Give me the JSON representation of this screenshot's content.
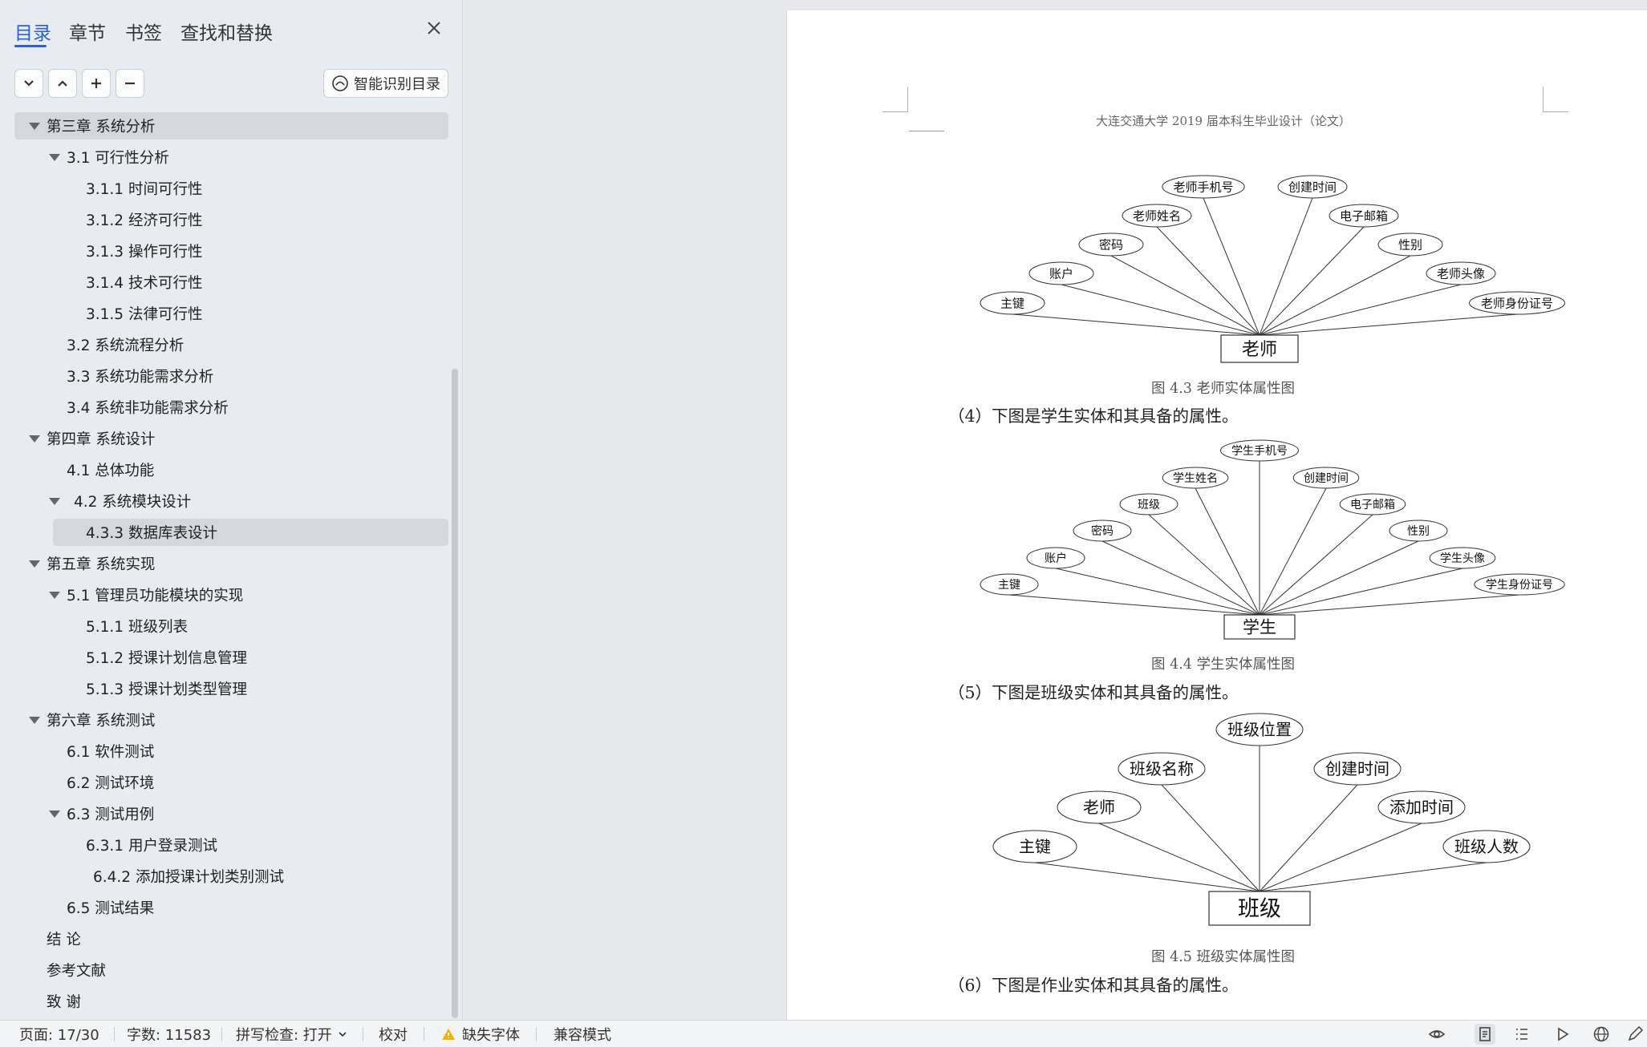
{
  "nav": {
    "tabs": [
      "目录",
      "章节",
      "书签",
      "查找和替换"
    ],
    "active_tab": 0,
    "ai_toc_label": "智能识别目录",
    "toc": [
      {
        "label": "第三章  系统分析",
        "level": 0,
        "expanded": true,
        "highlight": true
      },
      {
        "label": "3.1 可行性分析",
        "level": 1,
        "expanded": true
      },
      {
        "label": "3.1.1 时间可行性",
        "level": 2
      },
      {
        "label": "3.1.2  经济可行性",
        "level": 2
      },
      {
        "label": "3.1.3  操作可行性",
        "level": 2
      },
      {
        "label": "3.1.4  技术可行性",
        "level": 2
      },
      {
        "label": "3.1.5  法律可行性",
        "level": 2
      },
      {
        "label": "3.2 系统流程分析",
        "level": 1
      },
      {
        "label": "3.3 系统功能需求分析",
        "level": 1
      },
      {
        "label": "3.4  系统非功能需求分析",
        "level": 1
      },
      {
        "label": "第四章  系统设计",
        "level": 0,
        "expanded": true
      },
      {
        "label": "4.1  总体功能",
        "level": 1
      },
      {
        "label": "4.2  系统模块设计",
        "level": 1,
        "expanded": true
      },
      {
        "label": "4.3.3  数据库表设计",
        "level": 2,
        "selected": true
      },
      {
        "label": "第五章  系统实现",
        "level": 0,
        "expanded": true
      },
      {
        "label": "5.1  管理员功能模块的实现",
        "level": 1,
        "expanded": true
      },
      {
        "label": "5.1.1  班级列表",
        "level": 2
      },
      {
        "label": "5.1.2  授课计划信息管理",
        "level": 2
      },
      {
        "label": "5.1.3  授课计划类型管理",
        "level": 2
      },
      {
        "label": "第六章  系统测试",
        "level": 0,
        "expanded": true
      },
      {
        "label": "6.1 软件测试",
        "level": 1
      },
      {
        "label": "6.2 测试环境",
        "level": 1
      },
      {
        "label": "6.3  测试用例",
        "level": 1,
        "expanded": true
      },
      {
        "label": "6.3.1  用户登录测试",
        "level": 2
      },
      {
        "label": "6.4.2  添加授课计划类别测试",
        "level": 2
      },
      {
        "label": "6.5 测试结果",
        "level": 1
      },
      {
        "label": "结    论",
        "level": 0
      },
      {
        "label": "参考文献",
        "level": 0
      },
      {
        "label": "致    谢",
        "level": 0
      }
    ]
  },
  "document": {
    "running_header": "大连交通大学 2019 届本科生毕业设计（论文）",
    "figures": [
      {
        "entity": "老师",
        "caption": "图 4.3  老师实体属性图",
        "attributes": [
          "主键",
          "账户",
          "密码",
          "老师姓名",
          "老师手机号",
          "创建时间",
          "电子邮箱",
          "性别",
          "老师头像",
          "老师身份证号"
        ]
      },
      {
        "entity": "学生",
        "caption": "图 4.4  学生实体属性图",
        "attributes": [
          "主键",
          "账户",
          "密码",
          "班级",
          "学生姓名",
          "学生手机号",
          "创建时间",
          "电子邮箱",
          "性别",
          "学生头像",
          "学生身份证号"
        ]
      },
      {
        "entity": "班级",
        "caption": "图 4.5  班级实体属性图",
        "attributes": [
          "主键",
          "老师",
          "班级名称",
          "班级位置",
          "创建时间",
          "添加时间",
          "班级人数"
        ]
      }
    ],
    "paragraphs": [
      "（4）下图是学生实体和其具备的属性。",
      "（5）下图是班级实体和其具备的属性。",
      "（6）下图是作业实体和其具备的属性。"
    ]
  },
  "status": {
    "page": "页面: 17/30",
    "words": "字数: 11583",
    "spell": "拼写检查: 打开",
    "proof": "校对",
    "missing_font": "缺失字体",
    "compat": "兼容模式"
  },
  "colors": {
    "accent": "#2a62d6",
    "warning": "#f2b400"
  }
}
